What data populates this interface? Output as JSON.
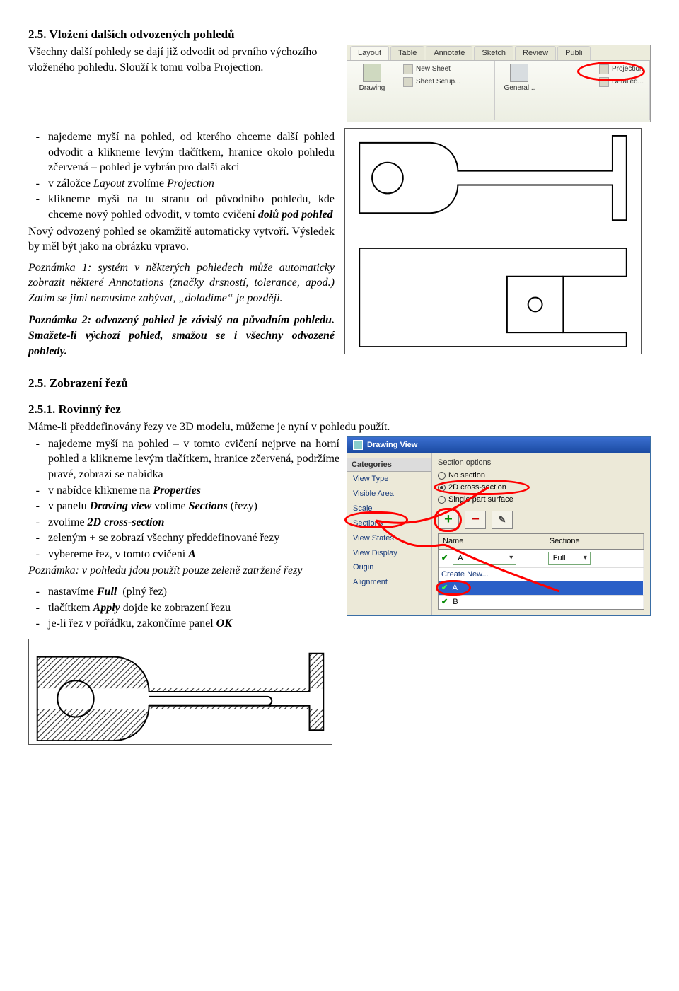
{
  "sec1": {
    "title": "2.5. Vložení dalších odvozených pohledů",
    "intro": "Všechny další pohledy se dají již odvodit od prvního výchozího vloženého pohledu. Slouží k tomu volba Projection."
  },
  "ribbon": {
    "tabs": [
      "Layout",
      "Table",
      "Annotate",
      "Sketch",
      "Review",
      "Publi"
    ],
    "group1_label": "Drawing",
    "new_sheet": "New Sheet",
    "sheet_setup": "Sheet Setup...",
    "general": "General...",
    "projection": "Projection",
    "detailed": "Detailed..."
  },
  "bullets1": [
    "najedeme myší na pohled, od kterého chceme další pohled odvodit a klikneme levým tlačítkem, hranice okolo pohledu zčervená – pohled je vybrán pro další akci",
    "v záložce Layout zvolíme Projection",
    "klikneme myší na tu stranu od původního pohledu, kde chceme nový pohled odvodit, v tomto cvičení dolů pod pohled"
  ],
  "derived_body": "Nový odvozený pohled se okamžitě automaticky vytvoří. Výsledek by měl být jako na obrázku vpravo.",
  "note1": "Poznámka 1: systém v některých pohledech může automaticky zobrazit některé Annotations (značky drsností, tolerance, apod.) Zatím se jimi nemusíme zabývat, „doladíme“ je později.",
  "note2": "Poznámka 2: odvozený pohled je závislý na původním pohledu. Smažete-li výchozí pohled, smažou se i všechny odvozené pohledy.",
  "sec2": {
    "title": "2.5. Zobrazení řezů"
  },
  "sec21": {
    "title": "2.5.1. Rovinný řez",
    "lead": "Máme-li předdefinovány řezy ve 3D modelu, můžeme je nyní v pohledu použít.",
    "b1": "najedeme myší na pohled – v tomto cvičení nejprve na horní pohled a klikneme levým tlačítkem, hranice zčervená, podržíme pravé, zobrazí se nabídka",
    "b2": "v nabídce klikneme na Properties",
    "b3": "v panelu Draving view volíme Sections (řezy)",
    "b4": "zvolíme 2D cross-section",
    "b5": "zeleným + se zobrazí všechny předdefinované řezy",
    "b6": "vybereme řez, v tomto cvičení A",
    "note": "Poznámka: v pohledu jdou použít pouze zeleně zatržené řezy",
    "b7": "nastavíme Full  (plný řez)",
    "b8": "tlačítkem Apply dojde ke zobrazení řezu",
    "b9": "je-li řez v pořádku, zakončíme panel OK"
  },
  "panel": {
    "title": "Drawing View",
    "cat_header": "Categories",
    "cats": [
      "View Type",
      "Visible Area",
      "Scale",
      "Sections",
      "View States",
      "View Display",
      "Origin",
      "Alignment"
    ],
    "section_options": "Section options",
    "r1": "No section",
    "r2": "2D cross-section",
    "r3": "Single part surface",
    "name_h": "Name",
    "sectioned_h": "Sectione",
    "sel_A": "A",
    "full": "Full",
    "create_new": "Create New...",
    "opt_a": "A",
    "opt_b": "B"
  }
}
